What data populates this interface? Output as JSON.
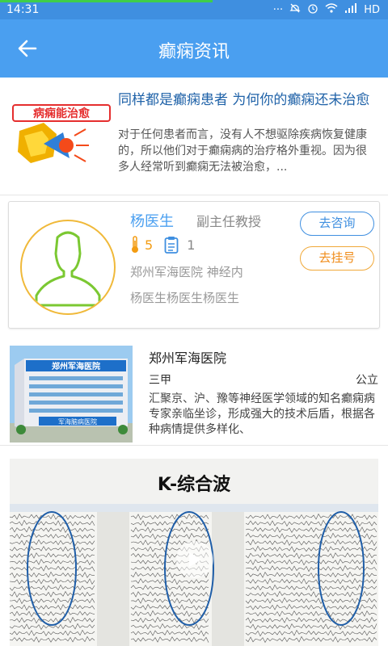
{
  "status_bar": {
    "time": "14:31",
    "network": "HD",
    "icons": [
      "more-icon",
      "mute-icon",
      "alarm-icon",
      "wifi-icon",
      "signal-icon",
      "battery-icon"
    ]
  },
  "app_bar": {
    "title": "癫痫资讯"
  },
  "news": {
    "thumb_text": "病痫能治愈",
    "title": "同样都是癫痫患者 为何你的癫痫还未治愈",
    "summary": "对于任何患者而言，没有人不想驱除疾病恢复健康的，所以他们对于癫痫病的治疗格外重视。因为很多人经常听到癫痫无法被治愈，..."
  },
  "doctor": {
    "name": "杨医生",
    "title": "副主任教授",
    "heat": "5",
    "count": "1",
    "hospital_dept": "郑州军海医院  神经内",
    "intro": "杨医生杨医生杨医生",
    "consult_label": "去咨询",
    "register_label": "去挂号"
  },
  "hospital": {
    "image_sign": "郑州军海医院",
    "image_footer": "军海脑病医院",
    "name": "郑州军海医院",
    "grade": "三甲",
    "type": "公立",
    "description": "汇聚京、沪、豫等神经医学领域的知名癫痫病专家亲临坐诊，形成强大的技术后盾，根据各种病情提供多样化、"
  },
  "video": {
    "title": "K-综合波"
  },
  "colors": {
    "accent": "#4a9ff0",
    "status_bar": "#3f8fe0",
    "news_title": "#1f62a8",
    "register_orange": "#f08c1a",
    "avatar_green": "#7bc832"
  }
}
